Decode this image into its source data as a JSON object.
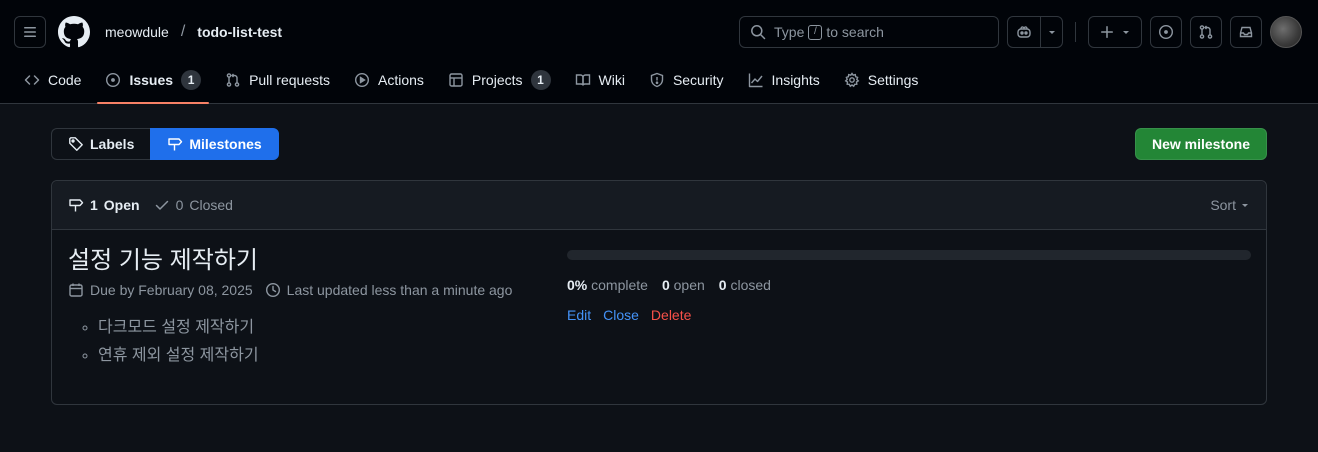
{
  "header": {
    "owner": "meowdule",
    "separator": "/",
    "repo": "todo-list-test",
    "search": {
      "prefix": "Type",
      "key": "/",
      "suffix": "to search"
    }
  },
  "nav": {
    "tabs": [
      {
        "label": "Code",
        "icon": "code-icon"
      },
      {
        "label": "Issues",
        "icon": "issue-opened-icon",
        "count": "1",
        "selected": true
      },
      {
        "label": "Pull requests",
        "icon": "git-pull-request-icon"
      },
      {
        "label": "Actions",
        "icon": "play-icon"
      },
      {
        "label": "Projects",
        "icon": "table-icon",
        "count": "1"
      },
      {
        "label": "Wiki",
        "icon": "book-icon"
      },
      {
        "label": "Security",
        "icon": "shield-icon"
      },
      {
        "label": "Insights",
        "icon": "graph-icon"
      },
      {
        "label": "Settings",
        "icon": "gear-icon"
      }
    ]
  },
  "subnav": {
    "labels": "Labels",
    "milestones": "Milestones",
    "new_milestone": "New milestone"
  },
  "list": {
    "open_count": "1",
    "open_label": "Open",
    "closed_count": "0",
    "closed_label": "Closed",
    "sort": "Sort"
  },
  "milestone": {
    "title": "설정 기능 제작하기",
    "due": "Due by February 08, 2025",
    "updated": "Last updated less than a minute ago",
    "items": [
      "다크모드 설정 제작하기",
      "연휴 제외 설정 제작하기"
    ],
    "progress_fraction": 0,
    "percent": "0%",
    "percent_label": "complete",
    "open_count": "0",
    "open_label": "open",
    "closed_count": "0",
    "closed_label": "closed",
    "edit": "Edit",
    "close": "Close",
    "delete": "Delete"
  },
  "colors": {
    "accent": "#1f6feb",
    "primary_button": "#238636",
    "danger": "#f85149",
    "link": "#4493f8",
    "selected_underline": "#f78166"
  }
}
